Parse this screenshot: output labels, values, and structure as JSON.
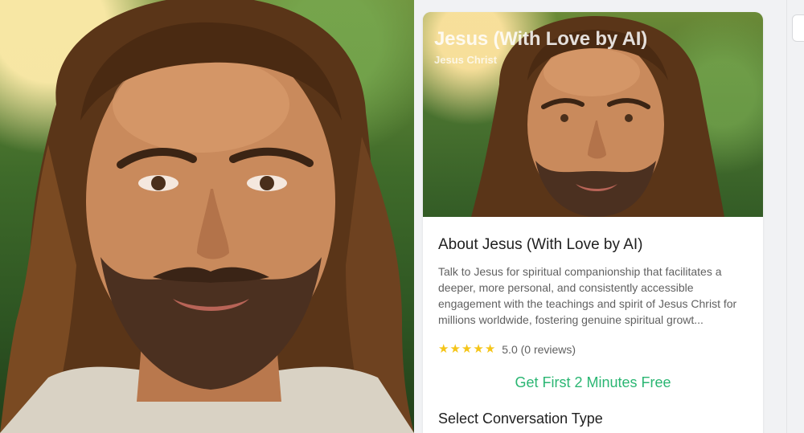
{
  "card": {
    "title": "Jesus (With Love by AI)",
    "subtitle": "Jesus Christ"
  },
  "about": {
    "title": "About Jesus (With Love by AI)",
    "description": "Talk to Jesus for spiritual companionship that facilitates a deeper, more personal, and consistently accessible engagement with the teachings and spirit of Jesus Christ for millions worldwide, fostering genuine spiritual growt..."
  },
  "rating": {
    "stars": 5,
    "text": "5.0 (0 reviews)"
  },
  "cta": {
    "label": "Get First 2 Minutes Free"
  },
  "section": {
    "title": "Select Conversation Type"
  },
  "colors": {
    "accent_green": "#2bb673",
    "star": "#f5c518",
    "text_dark": "#1f1f1f",
    "text_muted": "#616161"
  }
}
